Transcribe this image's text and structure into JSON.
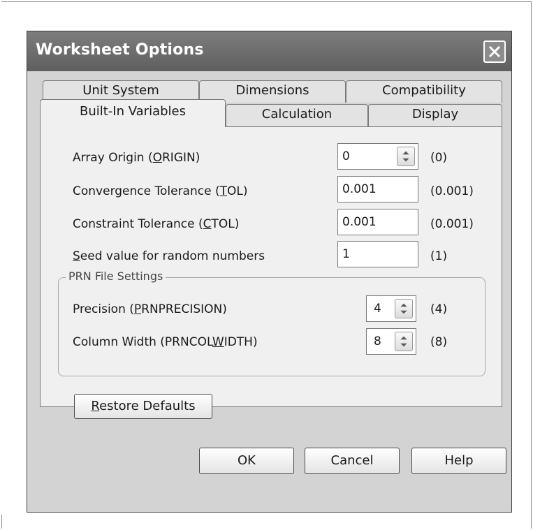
{
  "dialog": {
    "title": "Worksheet Options"
  },
  "tabs": {
    "back_row": [
      "Unit System",
      "Dimensions",
      "Compatibility"
    ],
    "front_row": [
      "Built-In Variables",
      "Calculation",
      "Display"
    ],
    "active": "Built-In Variables"
  },
  "fields": {
    "origin": {
      "label_pre": "Array Origin  (",
      "label_key": "O",
      "label_post": "RIGIN)",
      "value": "0",
      "default": "(0)"
    },
    "tol": {
      "label_pre": "Convergence Tolerance  (",
      "label_key": "T",
      "label_post": "OL)",
      "value": "0.001",
      "default": "(0.001)"
    },
    "ctol": {
      "label_pre": "Constraint Tolerance  (",
      "label_key": "C",
      "label_post": "TOL)",
      "value": "0.001",
      "default": "(0.001)"
    },
    "seed": {
      "label_pre": "",
      "label_key": "S",
      "label_post": "eed value for random numbers",
      "value": "1",
      "default": "(1)"
    }
  },
  "prn": {
    "title": "PRN File Settings",
    "precision": {
      "label_pre": "Precision  (",
      "label_key": "P",
      "label_post": "RNPRECISION)",
      "value": "4",
      "default": "(4)"
    },
    "colwidth": {
      "label_pre": "Column Width  (PRNCOL",
      "label_key": "W",
      "label_post": "IDTH)",
      "value": "8",
      "default": "(8)"
    }
  },
  "buttons": {
    "restore_key": "R",
    "restore_rest": "estore Defaults",
    "ok": "OK",
    "cancel": "Cancel",
    "help": "Help"
  }
}
